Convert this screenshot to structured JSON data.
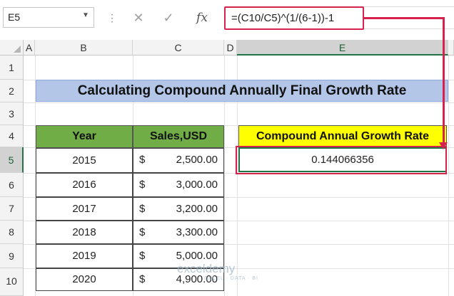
{
  "name_box": {
    "value": "E5"
  },
  "formula_bar": {
    "formula": "=(C10/C5)^(1/(6-1))-1",
    "fx_label": "fx"
  },
  "columns": [
    "A",
    "B",
    "C",
    "D",
    "E"
  ],
  "rows": [
    "1",
    "2",
    "3",
    "4",
    "5",
    "6",
    "7",
    "8",
    "9",
    "10"
  ],
  "title": "Calculating Compound Annually Final Growth Rate",
  "table": {
    "headers": [
      "Year",
      "Sales,USD"
    ],
    "rows": [
      {
        "year": "2015",
        "currency": "$",
        "sales": "2,500.00"
      },
      {
        "year": "2016",
        "currency": "$",
        "sales": "3,000.00"
      },
      {
        "year": "2017",
        "currency": "$",
        "sales": "3,200.00"
      },
      {
        "year": "2018",
        "currency": "$",
        "sales": "3,300.00"
      },
      {
        "year": "2019",
        "currency": "$",
        "sales": "5,000.00"
      },
      {
        "year": "2020",
        "currency": "$",
        "sales": "4,900.00"
      }
    ]
  },
  "cagr": {
    "label": "Compound Annual Growth Rate",
    "value": "0.144066356"
  },
  "watermark": {
    "brand": "exceldemy",
    "tagline": "EXCEL · DATA · BI"
  },
  "colors": {
    "title_fill": "#b4c6e7",
    "header_fill": "#70ad47",
    "cagr_fill": "#ffff00",
    "highlight": "#d6224c",
    "selection": "#217346"
  }
}
